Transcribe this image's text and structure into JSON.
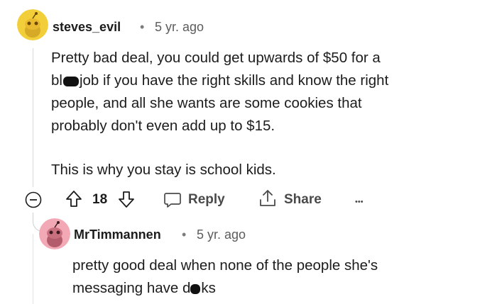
{
  "comment": {
    "username": "steves_evil",
    "separator": "•",
    "time": "5 yr. ago",
    "paragraph1_lines": [
      "Pretty bad deal, you could get upwards of $50 for a",
      "people, and all she wants are some cookies that",
      "probably don't even add up to $15."
    ],
    "line2_prefix": "bl",
    "line2_suffix": "job if you have the right skills and know the right",
    "paragraph2": "This is why you stay is school kids.",
    "actions": {
      "votes": "18",
      "reply_label": "Reply",
      "share_label": "Share",
      "more_label": "•••"
    }
  },
  "reply": {
    "username": "MrTimmannen",
    "separator": "•",
    "time": "5 yr. ago",
    "line1": "pretty good deal when none of the people she's",
    "line2_prefix": "messaging have d",
    "line2_suffix": "ks"
  },
  "colors": {
    "avatar1_bg": "#f2cf3a",
    "avatar2_bg": "#f3a9b5",
    "thread_line": "#d9d9d9"
  }
}
